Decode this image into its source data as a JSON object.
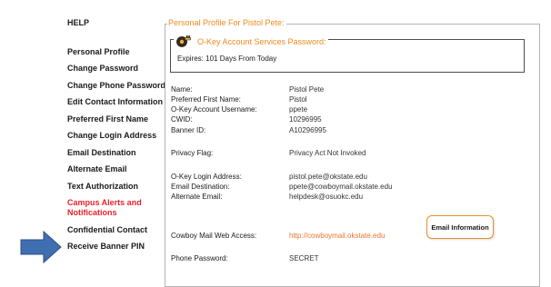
{
  "sidebar": {
    "help": "HELP",
    "items": [
      {
        "label": "Personal Profile",
        "accent": false
      },
      {
        "label": "Change Password",
        "accent": false
      },
      {
        "label": "Change Phone Password",
        "accent": false
      },
      {
        "label": "Edit Contact Information",
        "accent": false
      },
      {
        "label": "Preferred First Name",
        "accent": false
      },
      {
        "label": "Change Login Address",
        "accent": false
      },
      {
        "label": "Email Destination",
        "accent": false
      },
      {
        "label": "Alternate Email",
        "accent": false
      },
      {
        "label": "Text Authorization",
        "accent": false
      },
      {
        "label": "Campus Alerts and",
        "label2": "Notifications",
        "accent": true
      },
      {
        "label": "Confidential Contact",
        "accent": false
      },
      {
        "label": "Receive Banner PIN",
        "accent": false
      }
    ]
  },
  "panel": {
    "title": "Personal Profile For Pistol Pete:",
    "okey": {
      "title": "O-Key Account Services Password:",
      "expires_label": "Expires:",
      "expires_value": "101 Days From Today"
    },
    "fields": {
      "name": {
        "label": "Name:",
        "value": "Pistol Pete"
      },
      "preferred_first_name": {
        "label": "Preferred First Name:",
        "value": "Pistol"
      },
      "okey_username": {
        "label": "O-Key Account Username:",
        "value": "ppete"
      },
      "cwid": {
        "label": "CWID:",
        "value": "10296995"
      },
      "banner_id": {
        "label": "Banner ID:",
        "value": "A10296995"
      },
      "privacy_flag": {
        "label": "Privacy Flag:",
        "value": "Privacy Act Not Invoked"
      },
      "okey_login_address": {
        "label": "O-Key Login Address:",
        "value": "pistol.pete@okstate.edu"
      },
      "email_destination": {
        "label": "Email Destination:",
        "value": "ppete@cowboymail.okstate.edu"
      },
      "alternate_email": {
        "label": "Alternate Email:",
        "value": "helpdesk@osuokc.edu"
      },
      "cowboy_mail": {
        "label": "Cowboy Mail Web Access:",
        "value": "http://cowboymail.okstate.edu"
      },
      "phone_password": {
        "label": "Phone Password:",
        "value": "SECRET"
      }
    },
    "email_info_button": "Email Information"
  },
  "colors": {
    "accent_orange": "#f08a1e",
    "alert_red": "#e8212a",
    "arrow_blue": "#3f6fb0"
  },
  "icons": {
    "pointer": "right-arrow-icon",
    "okey": "key-lock-icon"
  }
}
